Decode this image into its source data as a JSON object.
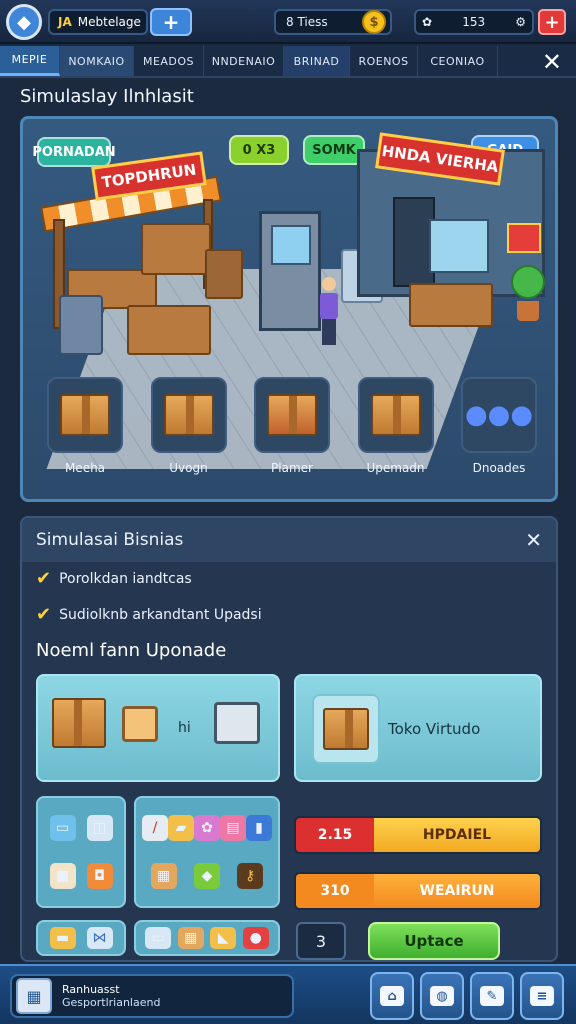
{
  "header": {
    "player_tag": "JA",
    "player_name": "Mebtelage",
    "add_label": "+",
    "coin_label": "8 Tiess",
    "gem_value": "153",
    "settings_label": "+"
  },
  "tabs": [
    "MEPIE",
    "NOMKAIO",
    "MEADOS",
    "NNDENAIO",
    "BRINAD",
    "ROENOS",
    "CEONIAO"
  ],
  "close_symbol": "✕",
  "section_title": "Simulaslay Ilnhlasit",
  "scene": {
    "chip_left": "PORNADAN",
    "chip_coins": "0 X3",
    "chip_green": "SOMK",
    "chip_right": "GAID",
    "stall_sign": "TOPDHRUN",
    "shop_sign": "HNDA VIERHA"
  },
  "categories": [
    {
      "label": "Meeha"
    },
    {
      "label": "Uvogn"
    },
    {
      "label": "Plamer"
    },
    {
      "label": "Upemadn"
    },
    {
      "label": "Dnoades"
    }
  ],
  "panel": {
    "title": "Simulasai Bisnias",
    "close_symbol": "✕",
    "checks": [
      "Porolkdan iandtcas",
      "Sudiolknb arkandtant Upadsi"
    ],
    "subheading": "Noeml fann Uponade",
    "card_text": "hi",
    "store_card": "Toko Virtudo",
    "bar1_value": "2.15",
    "bar1_label": "HPDAIEL",
    "bar2_value": "310",
    "bar2_label": "WEAIRUN",
    "quantity": "3",
    "upgrade_label": "Uptace"
  },
  "footer": {
    "line1": "Ranhuasst",
    "line2": "Gesportlrianlaend"
  }
}
